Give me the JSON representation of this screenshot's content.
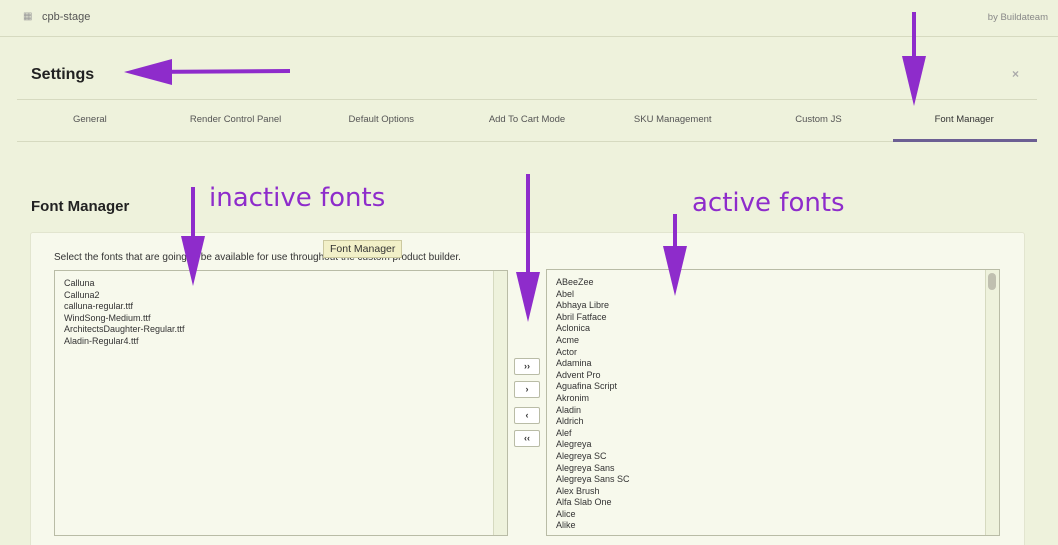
{
  "topbar": {
    "app_name": "cpb-stage",
    "by_text": "by Buildateam"
  },
  "header": {
    "title": "Settings",
    "close": "×"
  },
  "tabs": [
    {
      "label": "General"
    },
    {
      "label": "Render Control Panel"
    },
    {
      "label": "Default Options"
    },
    {
      "label": "Add To Cart Mode"
    },
    {
      "label": "SKU Management"
    },
    {
      "label": "Custom JS"
    },
    {
      "label": "Font Manager"
    }
  ],
  "active_tab": "Font Manager",
  "section": {
    "title": "Font Manager",
    "instructions": "Select the fonts that are going to be available for use throughout the custom product builder.",
    "tooltip": "Font Manager"
  },
  "inactive_fonts": [
    "Calluna",
    "Calluna2",
    "calluna-regular.ttf",
    "WindSong-Medium.ttf",
    "ArchitectsDaughter-Regular.ttf",
    "Aladin-Regular4.ttf"
  ],
  "active_fonts": [
    "ABeeZee",
    "Abel",
    "Abhaya Libre",
    "Abril Fatface",
    "Aclonica",
    "Acme",
    "Actor",
    "Adamina",
    "Advent Pro",
    "Aguafina Script",
    "Akronim",
    "Aladin",
    "Aldrich",
    "Alef",
    "Alegreya",
    "Alegreya SC",
    "Alegreya Sans",
    "Alegreya Sans SC",
    "Alex Brush",
    "Alfa Slab One",
    "Alice",
    "Alike"
  ],
  "move_buttons": {
    "all_right": "››",
    "right": "›",
    "left": "‹",
    "all_left": "‹‹"
  },
  "annotations": {
    "inactive": "inactive fonts",
    "active": "active fonts"
  },
  "colors": {
    "annotation": "#8e2ccb",
    "accent": "#6c5f93",
    "background": "#eef2dc"
  }
}
